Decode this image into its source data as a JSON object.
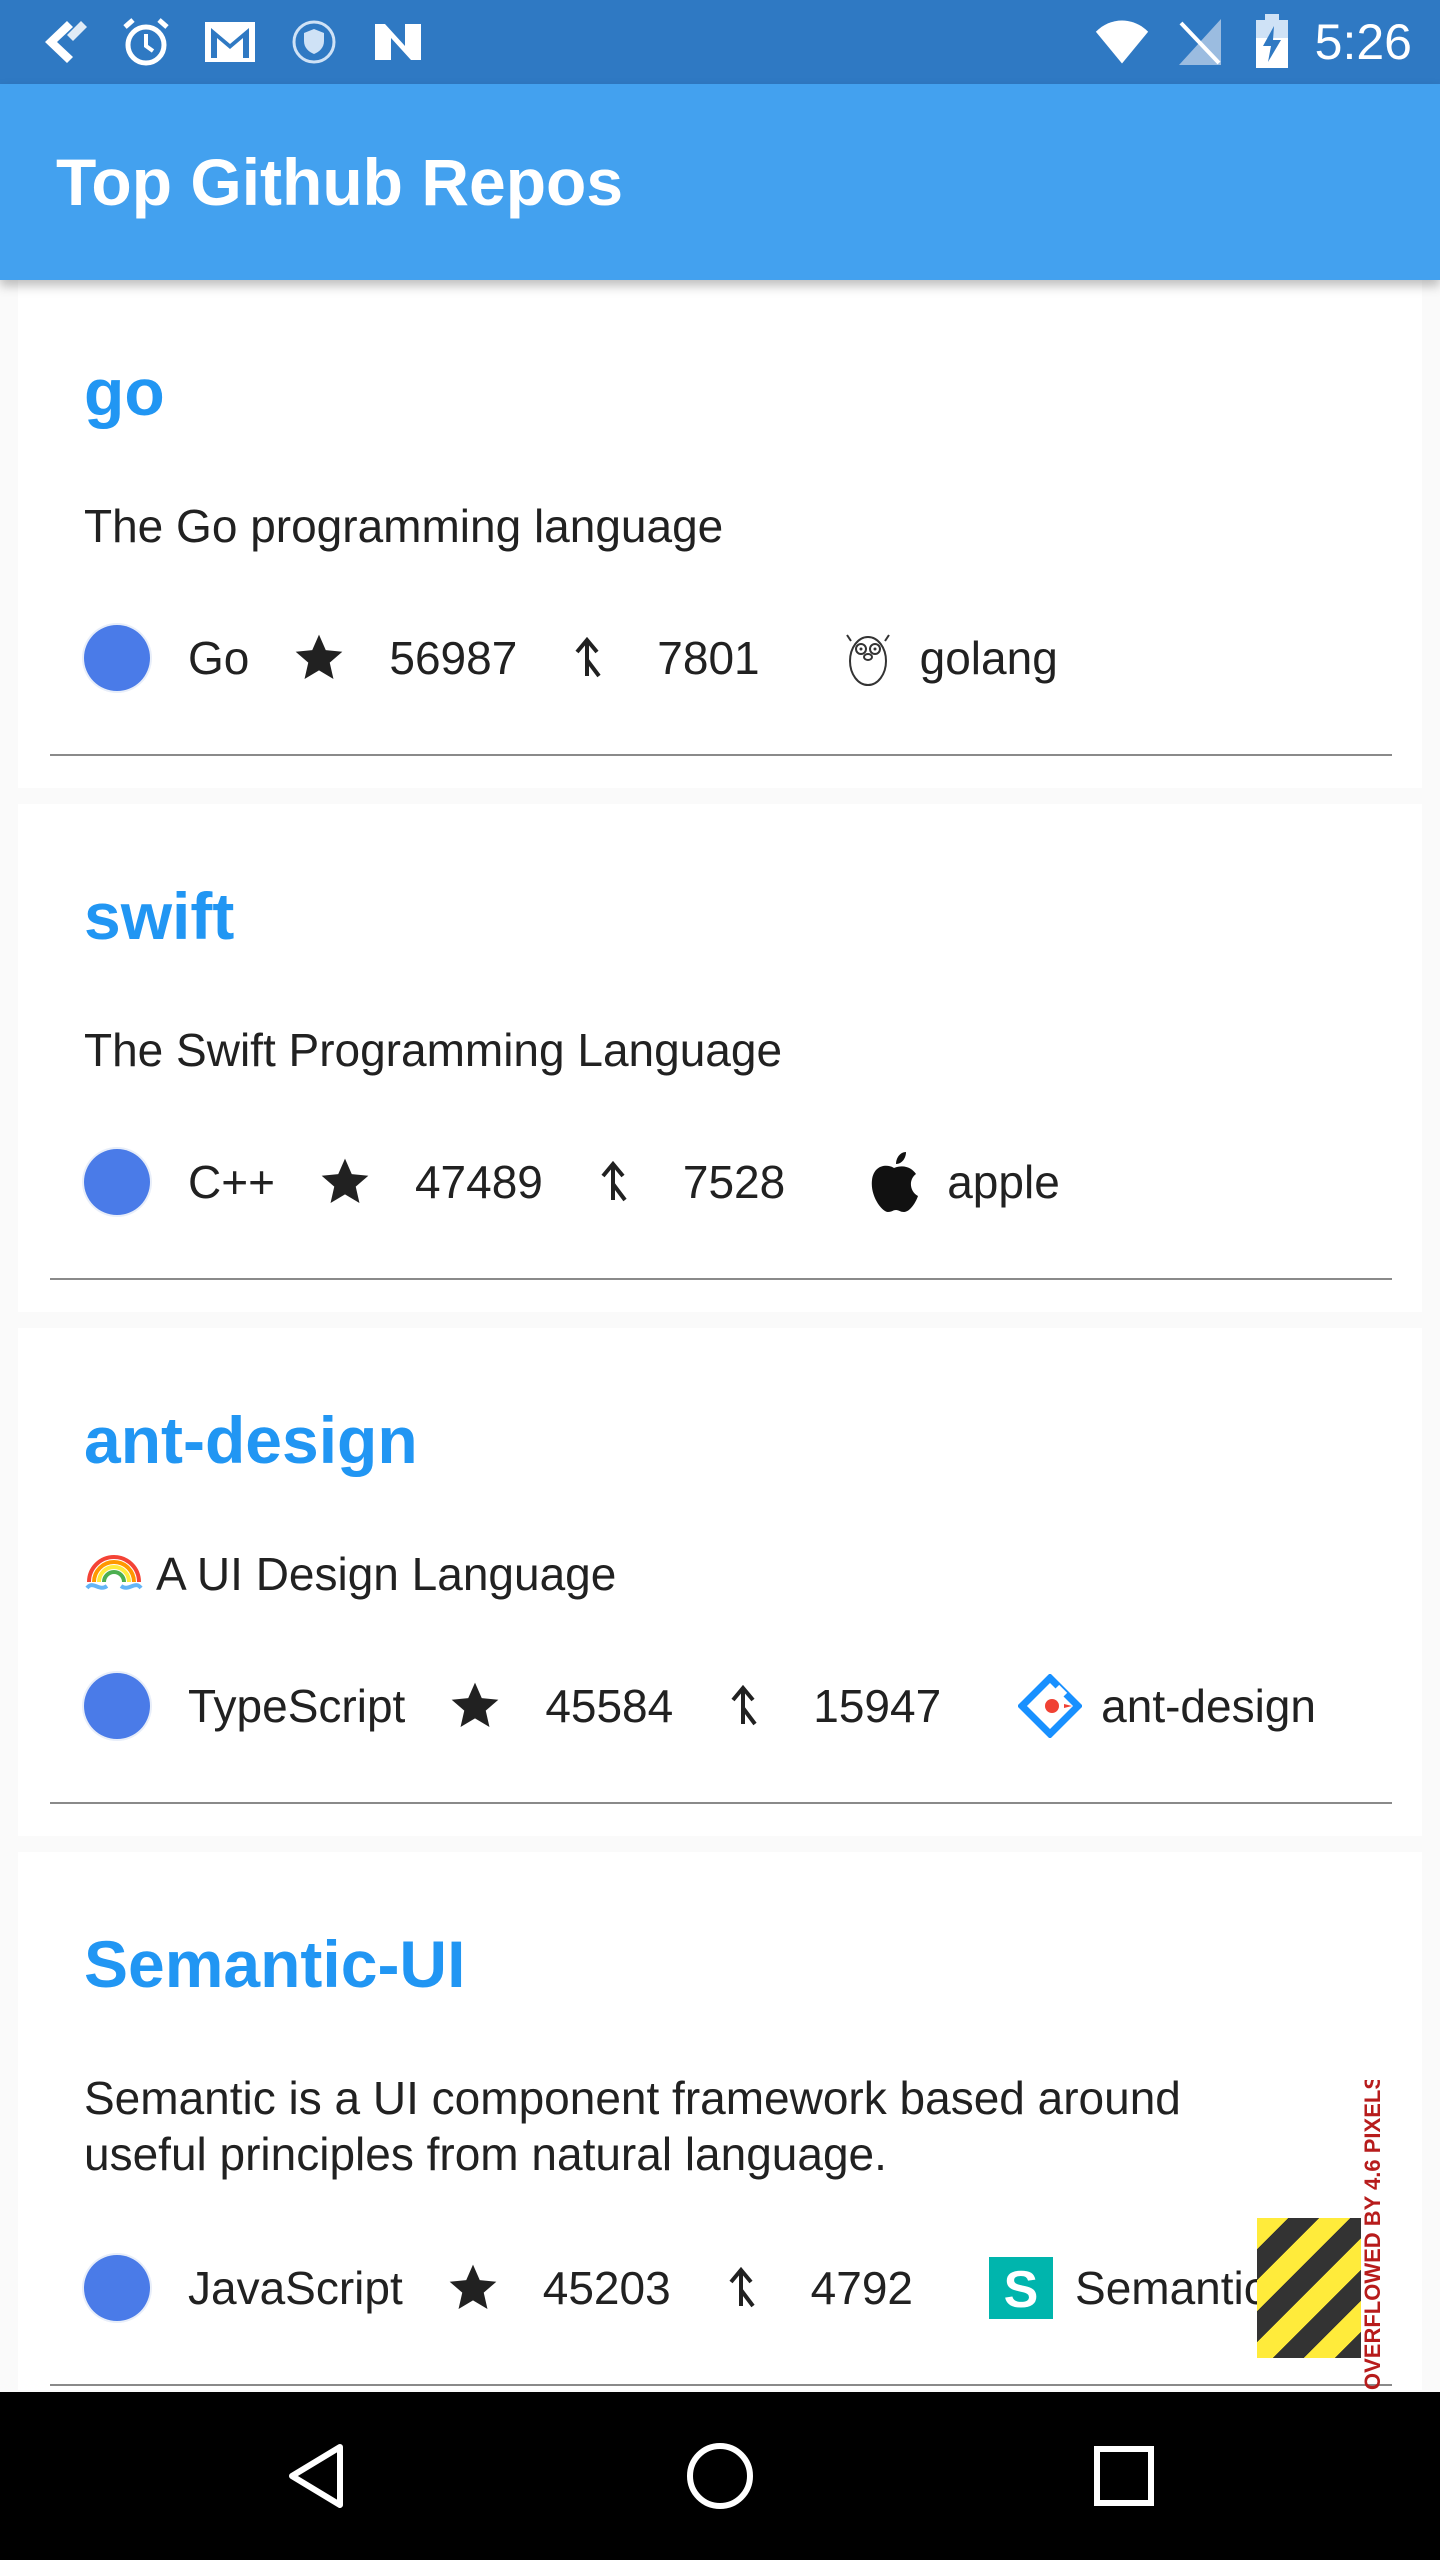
{
  "status_bar": {
    "time": "5:26",
    "left_icons": [
      "back-arrow-icon",
      "alarm-icon",
      "gmail-icon",
      "vpn-shield-icon",
      "n-app-icon"
    ],
    "right_icons": [
      "wifi-icon",
      "no-sim-icon",
      "battery-charging-icon"
    ]
  },
  "app_bar": {
    "title": "Top Github Repos"
  },
  "repos": [
    {
      "name": "go",
      "description": "The Go programming language",
      "language": "Go",
      "stars": "56987",
      "forks": "7801",
      "owner": "golang",
      "owner_icon": "gopher-icon"
    },
    {
      "name": "swift",
      "description": "The Swift Programming Language",
      "language": "C++",
      "stars": "47489",
      "forks": "7528",
      "owner": "apple",
      "owner_icon": "apple-logo-icon"
    },
    {
      "name": "ant-design",
      "description": "A UI Design Language",
      "description_prefix_icon": "rainbow-icon",
      "language": "TypeScript",
      "stars": "45584",
      "forks": "15947",
      "owner": "ant-design",
      "owner_icon": "ant-design-logo-icon"
    },
    {
      "name": "Semantic-UI",
      "description": "Semantic is a UI component framework based around useful principles from natural language.",
      "language": "JavaScript",
      "stars": "45203",
      "forks": "4792",
      "owner": "Semantic-O",
      "owner_icon": "semantic-s-logo-icon"
    }
  ],
  "overflow_warning": "OVERFLOWED BY 4.6 PIXELS",
  "colors": {
    "status_bar": "#2f79c3",
    "app_bar": "#43a1ef",
    "repo_name": "#2196f3",
    "language_dot": "#4a7be8"
  }
}
